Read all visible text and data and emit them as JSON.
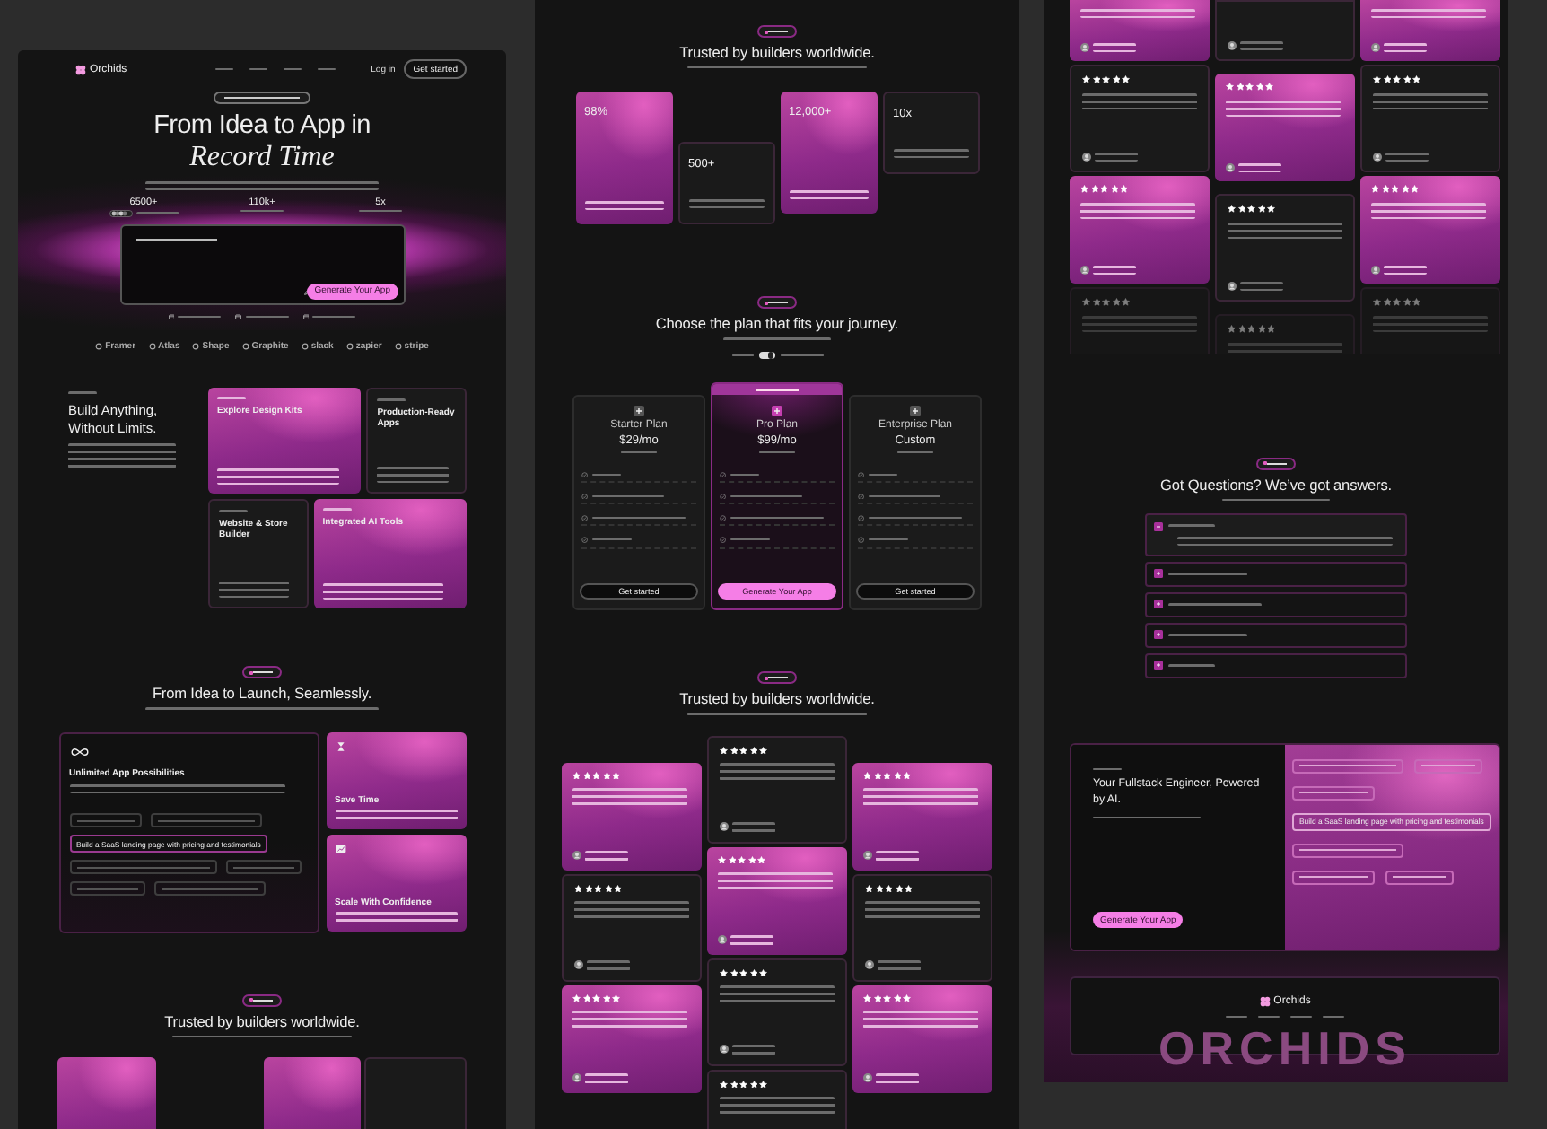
{
  "landing_top": {
    "nav": {
      "logo": "Orchids",
      "login": "Log in",
      "cta": "Get started"
    },
    "hero": {
      "title": "From Idea to App in",
      "title_accent": "Record Time",
      "stats": [
        {
          "value": "6500+",
          "kind": "avatars"
        },
        {
          "value": "110k+",
          "kind": "plain"
        },
        {
          "value": "5x",
          "kind": "plain"
        }
      ],
      "button": "Generate Your App",
      "logos": [
        "Framer",
        "Atlas",
        "Shape",
        "Graphite",
        "slack",
        "zapier",
        "stripe"
      ]
    },
    "products": {
      "title": "Build Anything, Without Limits.",
      "cards": [
        {
          "title": "Explore Design Kits",
          "highlighted": true
        },
        {
          "title": "Production-Ready Apps",
          "highlighted": false
        },
        {
          "title": "Website & Store Builder",
          "highlighted": false
        },
        {
          "title": "Integrated AI Tools",
          "highlighted": true
        }
      ]
    },
    "benefits": {
      "title": "From Idea to Launch, Seamlessly.",
      "main": {
        "title": "Unlimited App Possibilities",
        "prompt": "Build a SaaS landing page with pricing and testimonials"
      },
      "side": [
        {
          "title": "Save Time",
          "kind": "hourglass"
        },
        {
          "title": "Scale With Confidence",
          "kind": "chart"
        }
      ]
    },
    "trusted": {
      "title": "Trusted by builders worldwide.",
      "cards": [
        {
          "highlighted": true
        },
        {
          "highlighted": true
        },
        {
          "highlighted": false
        }
      ]
    }
  },
  "landing_middle": {
    "results": {
      "title": "Trusted by builders worldwide.",
      "cards": [
        {
          "value": "98%",
          "highlighted": true
        },
        {
          "value": "500+",
          "highlighted": false
        },
        {
          "value": "12,000+",
          "highlighted": true
        },
        {
          "value": "10x",
          "highlighted": false
        }
      ]
    },
    "pricing": {
      "title": "Choose the plan that fits your journey.",
      "toggle": {
        "on": true
      },
      "plans": [
        {
          "name": "Starter Plan",
          "price": "$29/mo",
          "featured": false,
          "button": "Get started"
        },
        {
          "name": "Pro Plan",
          "price": "$99/mo",
          "featured": true,
          "button": "Generate Your App"
        },
        {
          "name": "Enterprise Plan",
          "price": "Custom",
          "featured": false,
          "button": "Get started"
        }
      ]
    },
    "testimonials": {
      "title": "Trusted by builders worldwide.",
      "columns": [
        {
          "cards": [
            {
              "highlighted": true,
              "stars": 5
            },
            {
              "highlighted": false,
              "stars": 5
            },
            {
              "highlighted": true,
              "stars": 5
            }
          ]
        },
        {
          "cards": [
            {
              "highlighted": false,
              "stars": 5
            },
            {
              "highlighted": true,
              "stars": 5
            },
            {
              "highlighted": false,
              "stars": 5
            },
            {
              "highlighted": false,
              "stars": 5
            }
          ]
        },
        {
          "cards": [
            {
              "highlighted": true,
              "stars": 5
            },
            {
              "highlighted": false,
              "stars": 5
            },
            {
              "highlighted": true,
              "stars": 5
            }
          ]
        }
      ]
    }
  },
  "landing_bottom": {
    "testimonials": {
      "columns": [
        {
          "cards": [
            {
              "highlighted": true
            },
            {
              "highlighted": false,
              "stars": 5
            },
            {
              "highlighted": true,
              "stars": 5
            },
            {
              "highlighted": false,
              "stars": 5
            }
          ]
        },
        {
          "cards": [
            {
              "highlighted": false
            },
            {
              "highlighted": true,
              "stars": 5
            },
            {
              "highlighted": false,
              "stars": 5
            },
            {
              "highlighted": false,
              "stars": 5
            }
          ]
        },
        {
          "cards": [
            {
              "highlighted": true
            },
            {
              "highlighted": false,
              "stars": 5
            },
            {
              "highlighted": true,
              "stars": 5
            },
            {
              "highlighted": false,
              "stars": 5
            }
          ]
        }
      ]
    },
    "faq": {
      "title": "Got Questions? We’ve got answers.",
      "items": [
        {
          "expanded": true
        },
        {
          "expanded": false
        },
        {
          "expanded": false
        },
        {
          "expanded": false
        },
        {
          "expanded": false
        }
      ]
    },
    "cta": {
      "title": "Your Fullstack Engineer, Powered by AI.",
      "button": "Generate Your App",
      "prompt": "Build a SaaS landing page with pricing and testimonials"
    },
    "footer": {
      "logo": "Orchids",
      "wordmark": "ORCHIDS"
    }
  }
}
